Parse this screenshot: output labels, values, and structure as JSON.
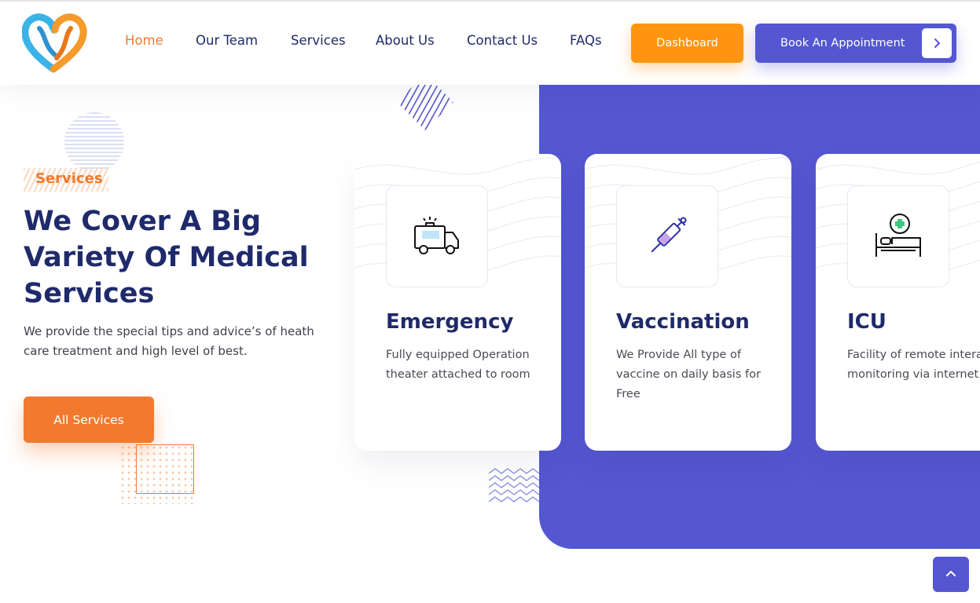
{
  "header": {
    "logo_icon": "heart-logo-icon",
    "nav": [
      {
        "label": "Home",
        "active": true
      },
      {
        "label": "Our Team",
        "active": false
      },
      {
        "label": "Services",
        "active": false
      },
      {
        "label": "About Us",
        "active": false
      },
      {
        "label": "Contact Us",
        "active": false
      },
      {
        "label": "FAQs",
        "active": false
      }
    ],
    "dashboard_label": "Dashboard",
    "book_label": "Book An Appointment",
    "book_icon": "chevron-right-icon"
  },
  "hero": {
    "tag": "Services",
    "headline": "We Cover A Big Variety Of Medical Services",
    "lead": "We provide the special tips and advice’s of heath care treatment and high level of best.",
    "cta_label": "All Services"
  },
  "services": [
    {
      "icon": "ambulance-icon",
      "title": "Emergency",
      "text": "Fully equipped Operation theater attached to room"
    },
    {
      "icon": "syringe-icon",
      "title": "Vaccination",
      "text": "We Provide All type of vaccine on daily basis for Free"
    },
    {
      "icon": "hospital-bed-icon",
      "title": "ICU",
      "text": "Facility of remote interactive monitoring via internet."
    }
  ],
  "scroll_top_icon": "chevron-up-icon",
  "colors": {
    "primary": "#5457d1",
    "accent_orange": "#f27a2f",
    "dashboard_orange": "#ff9510",
    "heading_navy": "#1f2a6b"
  }
}
